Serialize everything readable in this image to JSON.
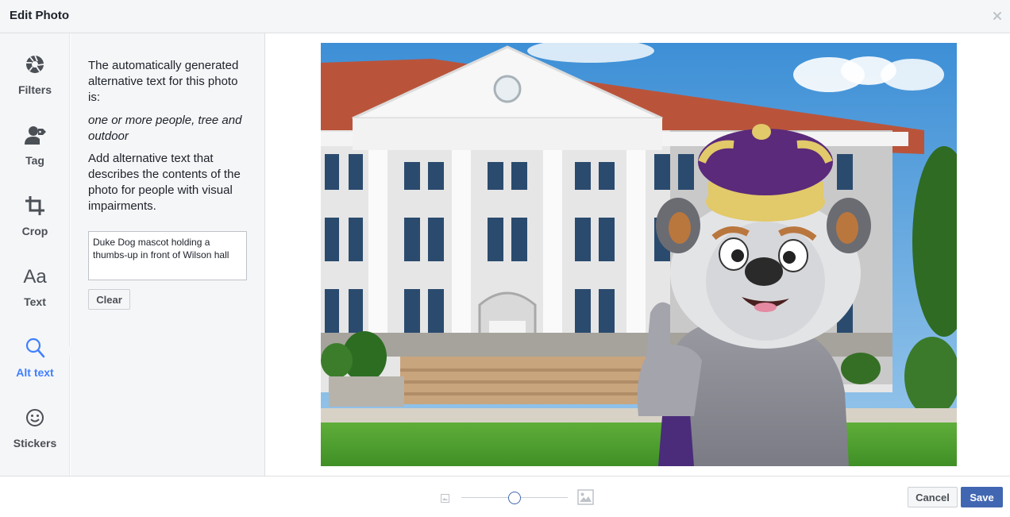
{
  "dialog": {
    "title": "Edit Photo"
  },
  "tools": [
    {
      "label": "Filters",
      "icon": "filters-aperture-icon"
    },
    {
      "label": "Tag",
      "icon": "tag-person-icon"
    },
    {
      "label": "Crop",
      "icon": "crop-icon"
    },
    {
      "label": "Text",
      "icon": "text-aa-icon",
      "glyph": "Aa"
    },
    {
      "label": "Alt text",
      "icon": "magnifier-icon",
      "active": true
    },
    {
      "label": "Stickers",
      "icon": "smiley-icon"
    }
  ],
  "alt_panel": {
    "intro": "The automatically generated alternative text for this photo is:",
    "generated": "one or more people, tree and outdoor",
    "instructions": "Add alternative text that describes the contents of the photo for people with visual impairments.",
    "input_value": "Duke Dog mascot holding a thumbs-up in front of Wilson hall",
    "clear_label": "Clear"
  },
  "photo": {
    "description_icon": "photo-image"
  },
  "footer": {
    "zoom_level": 0.5,
    "cancel_label": "Cancel",
    "save_label": "Save"
  },
  "colors": {
    "accent": "#4267b2",
    "active_tool": "#4080ff",
    "panel_bg": "#f5f6f7"
  }
}
